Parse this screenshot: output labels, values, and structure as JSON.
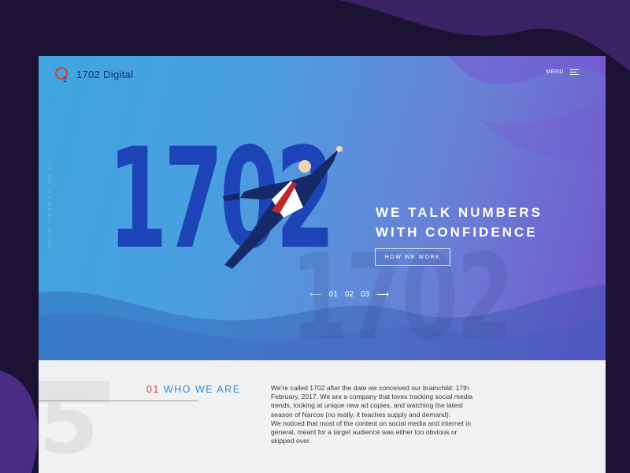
{
  "brand": {
    "logo_text": "1702 Digital"
  },
  "header": {
    "menu_label": "MENU"
  },
  "hero": {
    "big_number": "1702",
    "ghost_number": "1702",
    "vertical_text": "LOREM IPSUM DOLOR SIT",
    "title_line1": "WE TALK NUMBERS",
    "title_line2": "WITH CONFIDENCE",
    "cta_label": "HOW WE WORK",
    "pager": {
      "prev": "⟵",
      "pages": [
        "01",
        "02",
        "03"
      ],
      "next": "⟶"
    }
  },
  "section": {
    "bg_number": "5",
    "number": "01",
    "title": "WHO WE ARE",
    "paragraph1": "We're called 1702 after the date we conceived our brainchild: 17th February, 2017. We are a company that loves tracking social media trends, looking at unique new ad copies, and watching the latest season of Narcos (no really, it teaches supply and demand).",
    "paragraph2": "We noticed that most of the content on social media and internet in general, meant for a target audience was either too obvious or skipped over."
  },
  "colors": {
    "accent_red": "#d63c3c",
    "accent_blue": "#2f8fd0",
    "hero_number": "#1e45b8"
  }
}
